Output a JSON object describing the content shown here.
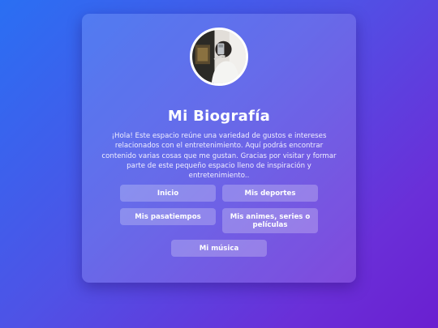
{
  "profile": {
    "avatar_icon": "profile-photo",
    "title": "Mi Biografía",
    "bio": "¡Hola! Este espacio reúne una variedad de gustos e intereses relacionados con el entretenimiento. Aquí podrás encontrar contenido varias cosas que me gustan. Gracias por visitar y formar parte de este pequeño espacio lleno de inspiración y entretenimiento.."
  },
  "nav": {
    "inicio": "Inicio",
    "deportes": "Mis deportes",
    "pasatiempos": "Mis pasatiempos",
    "animes": "Mis animes, series o películas",
    "musica": "Mi música"
  },
  "colors": {
    "background_start": "#2a6ff3",
    "background_end": "#6a1fd0",
    "text": "#ffffff"
  }
}
